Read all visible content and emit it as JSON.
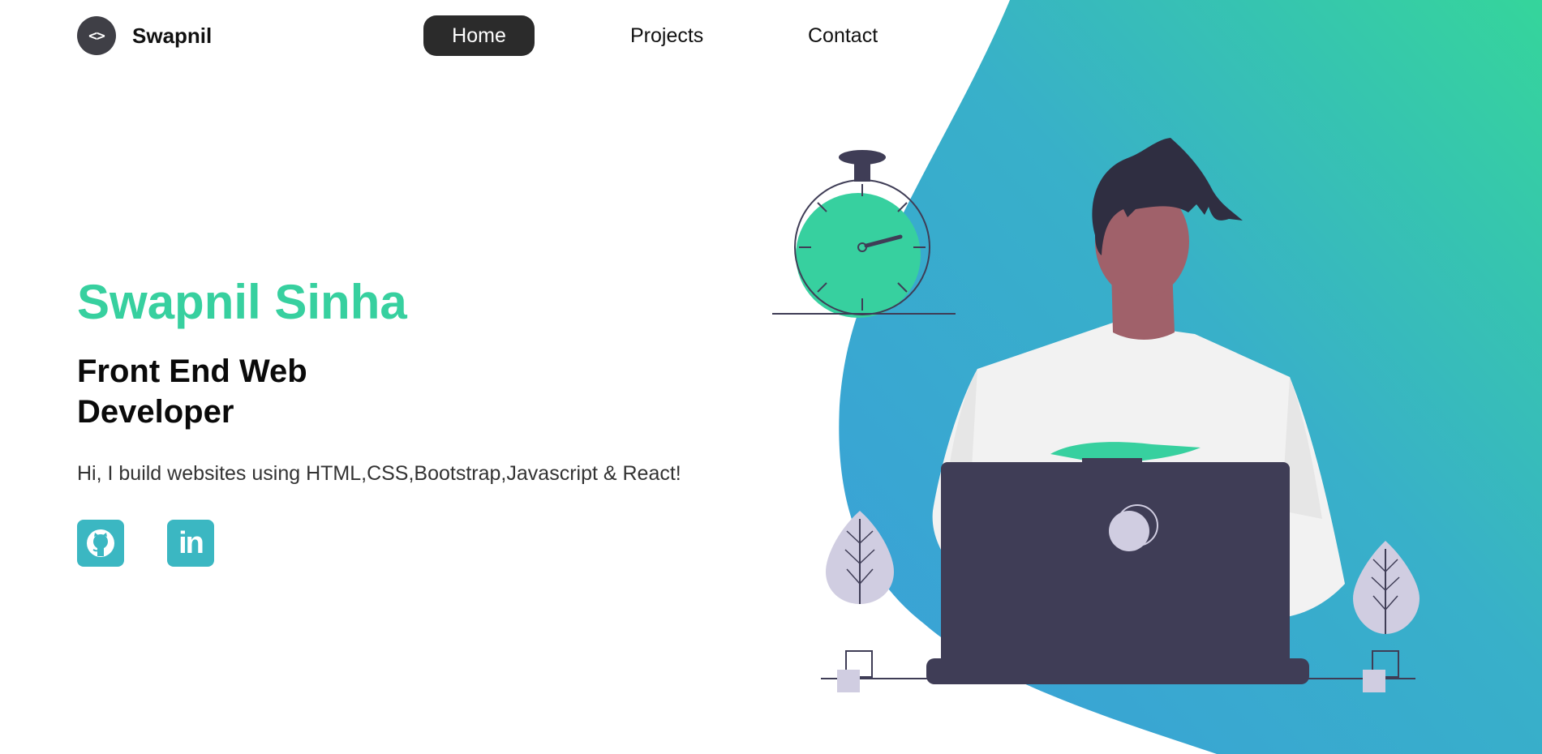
{
  "brand": {
    "logo_text": "<>",
    "name": "Swapnil"
  },
  "nav": {
    "items": [
      {
        "label": "Home",
        "active": true
      },
      {
        "label": "Projects",
        "active": false
      },
      {
        "label": "Contact",
        "active": false
      }
    ]
  },
  "hero": {
    "name": "Swapnil Sinha",
    "role": "Front End Web Developer",
    "intro": "Hi, I build websites using HTML,CSS,Bootstrap,Javascript & React!"
  },
  "social": [
    {
      "icon": "github-icon"
    },
    {
      "icon": "linkedin-icon",
      "text": "in"
    }
  ],
  "colors": {
    "accent": "#37d09f",
    "gradient_start": "#3aa2d8",
    "gradient_end": "#35d29a",
    "nav_active_bg": "#2b2b2b",
    "social_bg": "#3bb7c2",
    "laptop": "#3f3d56",
    "skin": "#a0616a",
    "plant": "#d0cde1"
  }
}
